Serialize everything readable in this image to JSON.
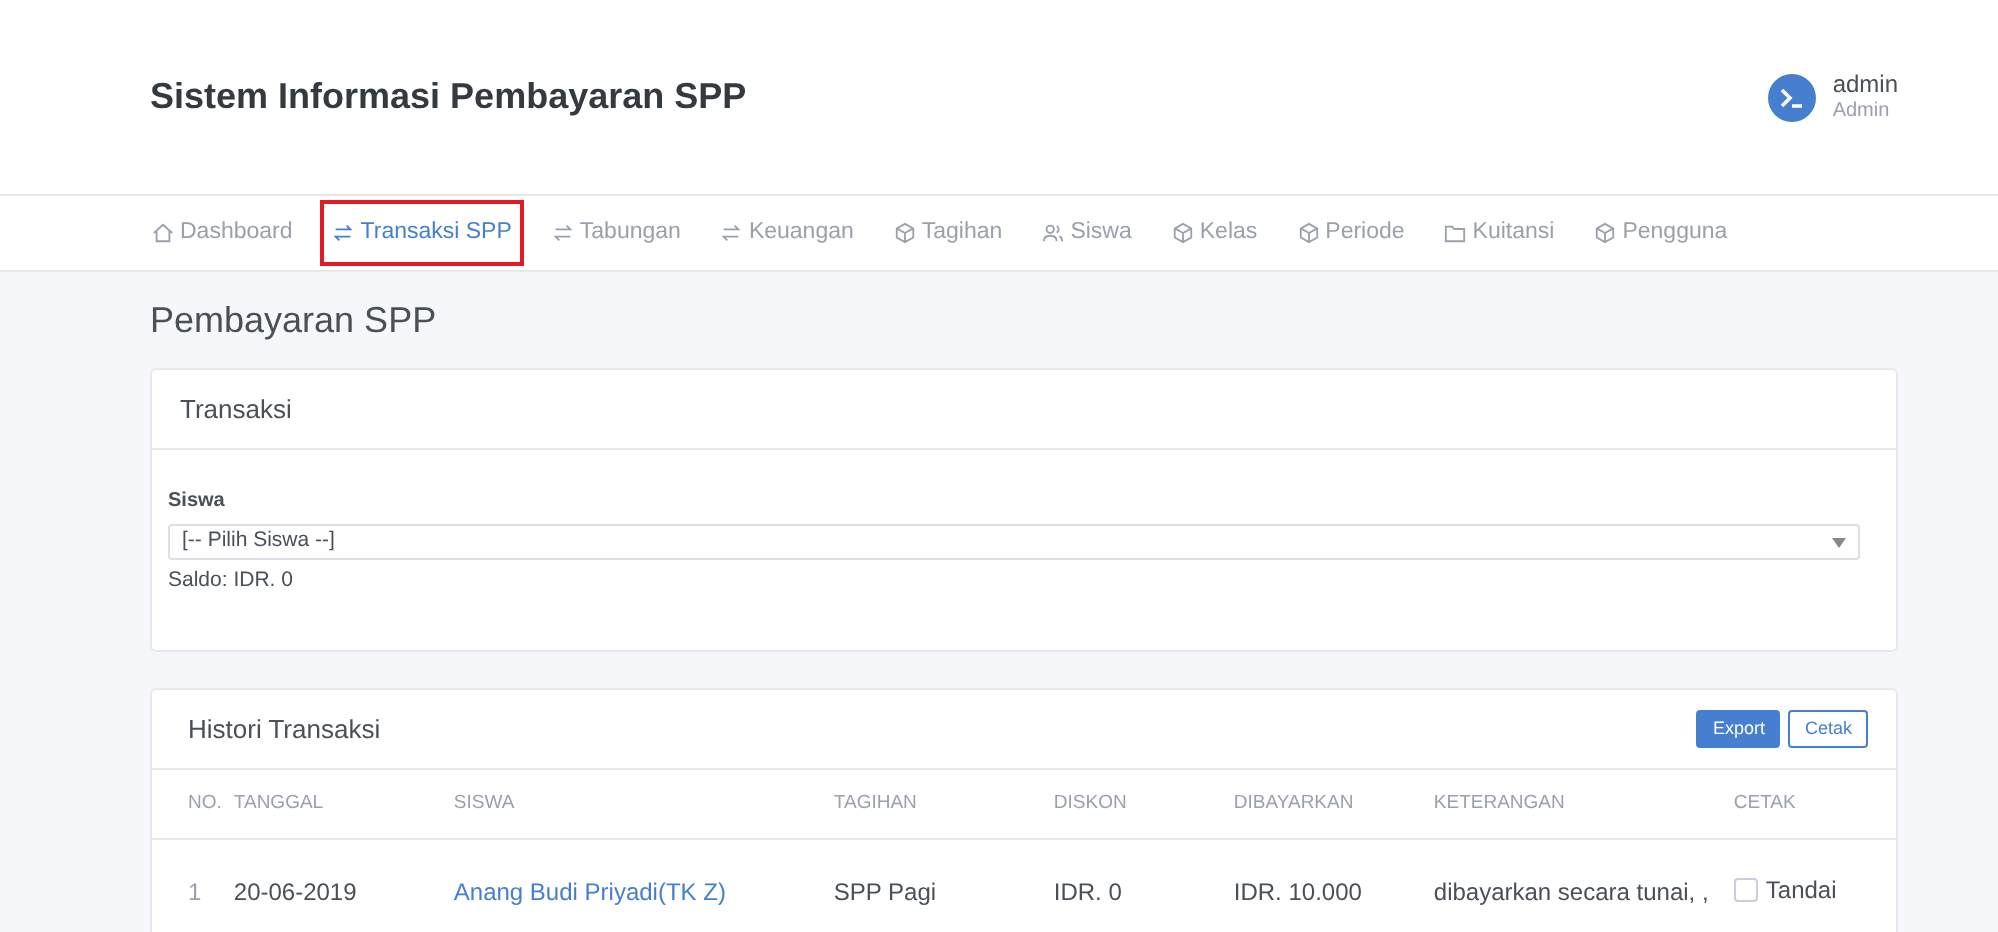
{
  "header": {
    "title": "Sistem Informasi Pembayaran SPP",
    "user": {
      "name": "admin",
      "role": "Admin"
    }
  },
  "nav": [
    {
      "label": "Dashboard",
      "kind": "home",
      "selected": false
    },
    {
      "label": "Transaksi SPP",
      "kind": "swap",
      "selected": true
    },
    {
      "label": "Tabungan",
      "kind": "swap",
      "selected": false
    },
    {
      "label": "Keuangan",
      "kind": "swap",
      "selected": false
    },
    {
      "label": "Tagihan",
      "kind": "box",
      "selected": false
    },
    {
      "label": "Siswa",
      "kind": "users",
      "selected": false
    },
    {
      "label": "Kelas",
      "kind": "box",
      "selected": false
    },
    {
      "label": "Periode",
      "kind": "box",
      "selected": false
    },
    {
      "label": "Kuitansi",
      "kind": "folder",
      "selected": false
    },
    {
      "label": "Pengguna",
      "kind": "box",
      "selected": false
    }
  ],
  "page_title": "Pembayaran SPP",
  "transaksi": {
    "title": "Transaksi",
    "field_label": "Siswa",
    "select_value": "[-- Pilih Siswa --]",
    "saldo": "Saldo: IDR. 0"
  },
  "histori": {
    "title": "Histori Transaksi",
    "buttons": [
      {
        "label": "Export",
        "kind": "primary"
      },
      {
        "label": "Cetak",
        "kind": "outline"
      }
    ],
    "columns": [
      "NO.",
      "TANGGAL",
      "SISWA",
      "TAGIHAN",
      "DISKON",
      "DIBAYARKAN",
      "KETERANGAN",
      "CETAK"
    ],
    "rows": [
      {
        "no": "1",
        "tanggal": "20-06-2019",
        "siswa": "Anang Budi Priyadi(TK Z)",
        "tagihan": "SPP Pagi",
        "diskon": "IDR. 0",
        "dibayarkan": "IDR. 10.000",
        "keterangan": "dibayarkan secara tunai, ,",
        "cetak": {
          "label": "Tandai",
          "checked": false
        }
      }
    ]
  }
}
